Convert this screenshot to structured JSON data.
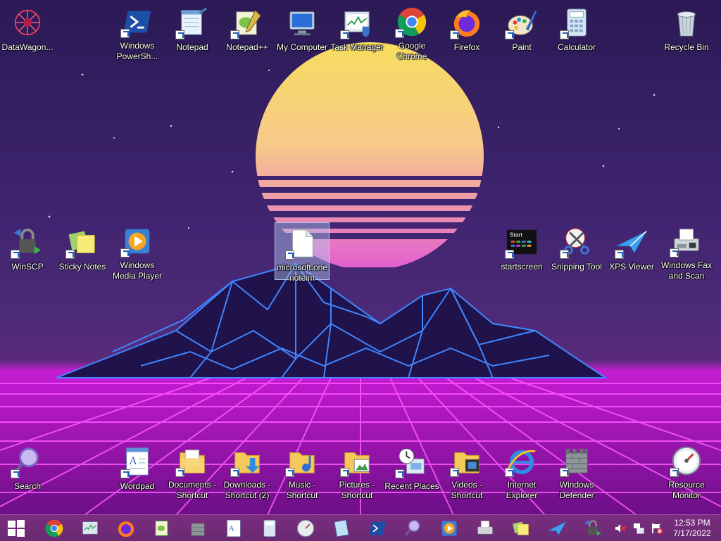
{
  "desktop_icons": [
    {
      "label": "DataWagon...",
      "icon": "datawagon-icon",
      "shortcut": false
    },
    {
      "label": "Windows\nPowerSh...",
      "icon": "powershell-icon",
      "shortcut": true
    },
    {
      "label": "Notepad",
      "icon": "notepad-icon",
      "shortcut": true
    },
    {
      "label": "Notepad++",
      "icon": "notepadpp-icon",
      "shortcut": true
    },
    {
      "label": "My Computer",
      "icon": "computer-icon",
      "shortcut": false
    },
    {
      "label": "Task Manager",
      "icon": "task-manager-icon",
      "shortcut": true
    },
    {
      "label": "Google\nChrome",
      "icon": "chrome-icon",
      "shortcut": true
    },
    {
      "label": "Firefox",
      "icon": "firefox-icon",
      "shortcut": true
    },
    {
      "label": "Paint",
      "icon": "paint-icon",
      "shortcut": true
    },
    {
      "label": "Calculator",
      "icon": "calculator-icon",
      "shortcut": true
    },
    {
      "label": "Recycle Bin",
      "icon": "recycle-bin-icon",
      "shortcut": false
    },
    {
      "label": "WinSCP",
      "icon": "winscp-icon",
      "shortcut": true
    },
    {
      "label": "Sticky Notes",
      "icon": "sticky-notes-icon",
      "shortcut": true
    },
    {
      "label": "Windows\nMedia Player",
      "icon": "media-player-icon",
      "shortcut": true
    },
    {
      "label": "microsoft.one\nnoteim",
      "icon": "file-icon",
      "shortcut": true
    },
    {
      "label": "startscreen",
      "icon": "startscreen-icon",
      "shortcut": true
    },
    {
      "label": "Snipping Tool",
      "icon": "snipping-tool-icon",
      "shortcut": true
    },
    {
      "label": "XPS Viewer",
      "icon": "xps-viewer-icon",
      "shortcut": true
    },
    {
      "label": "Windows Fax\nand Scan",
      "icon": "fax-scan-icon",
      "shortcut": true
    },
    {
      "label": "Search",
      "icon": "search-icon",
      "shortcut": true
    },
    {
      "label": "Wordpad",
      "icon": "wordpad-icon",
      "shortcut": true
    },
    {
      "label": "Documents -\nShortcut",
      "icon": "documents-folder-icon",
      "shortcut": true
    },
    {
      "label": "Downloads -\nShortcut (2)",
      "icon": "downloads-folder-icon",
      "shortcut": true
    },
    {
      "label": "Music -\nShortcut",
      "icon": "music-folder-icon",
      "shortcut": true
    },
    {
      "label": "Pictures -\nShortcut",
      "icon": "pictures-folder-icon",
      "shortcut": true
    },
    {
      "label": "Recent Places",
      "icon": "recent-places-icon",
      "shortcut": true
    },
    {
      "label": "Videos -\nShortcut",
      "icon": "videos-folder-icon",
      "shortcut": true
    },
    {
      "label": "Internet\nExplorer",
      "icon": "ie-icon",
      "shortcut": true
    },
    {
      "label": "Windows\nDefender",
      "icon": "defender-icon",
      "shortcut": true
    },
    {
      "label": "Resource\nMonitor",
      "icon": "resource-monitor-icon",
      "shortcut": true
    }
  ],
  "selected_icon": "microsoft.one\nnoteim",
  "taskbar": {
    "start": "windows-start-icon",
    "pinned": [
      "chrome-icon",
      "task-manager-icon",
      "firefox-icon",
      "notepadpp-icon",
      "defender-icon",
      "wordpad-icon",
      "calculator-icon",
      "resource-monitor-icon",
      "xps-viewer-icon",
      "powershell-icon",
      "search-icon",
      "media-player-icon",
      "fax-scan-icon",
      "sticky-notes-icon",
      "xps-viewer-icon",
      "winscp-icon"
    ],
    "tray": [
      "volume-muted-icon",
      "network-icon",
      "action-center-icon"
    ],
    "time": "12:53 PM",
    "date": "7/17/2022"
  },
  "colors": {
    "sky_top": "#2b1a55",
    "sun_top": "#f6d66a",
    "sun_bottom": "#e86fc0",
    "mountain_line": "#3a7bff",
    "grid": "#ff3cff",
    "taskbar": "#722c78"
  }
}
